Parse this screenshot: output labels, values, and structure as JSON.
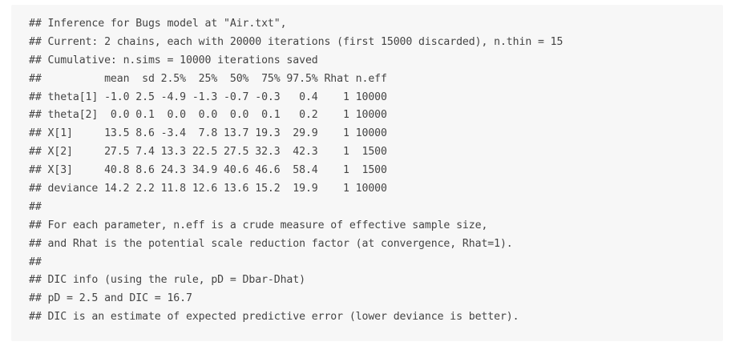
{
  "output_lines": [
    "## Inference for Bugs model at \"Air.txt\",",
    "## Current: 2 chains, each with 20000 iterations (first 15000 discarded), n.thin = 15",
    "## Cumulative: n.sims = 10000 iterations saved",
    "##          mean  sd 2.5%  25%  50%  75% 97.5% Rhat n.eff",
    "## theta[1] -1.0 2.5 -4.9 -1.3 -0.7 -0.3   0.4    1 10000",
    "## theta[2]  0.0 0.1  0.0  0.0  0.0  0.1   0.2    1 10000",
    "## X[1]     13.5 8.6 -3.4  7.8 13.7 19.3  29.9    1 10000",
    "## X[2]     27.5 7.4 13.3 22.5 27.5 32.3  42.3    1  1500",
    "## X[3]     40.8 8.6 24.3 34.9 40.6 46.6  58.4    1  1500",
    "## deviance 14.2 2.2 11.8 12.6 13.6 15.2  19.9    1 10000",
    "##",
    "## For each parameter, n.eff is a crude measure of effective sample size,",
    "## and Rhat is the potential scale reduction factor (at convergence, Rhat=1).",
    "##",
    "## DIC info (using the rule, pD = Dbar-Dhat)",
    "## pD = 2.5 and DIC = 16.7",
    "## DIC is an estimate of expected predictive error (lower deviance is better)."
  ]
}
